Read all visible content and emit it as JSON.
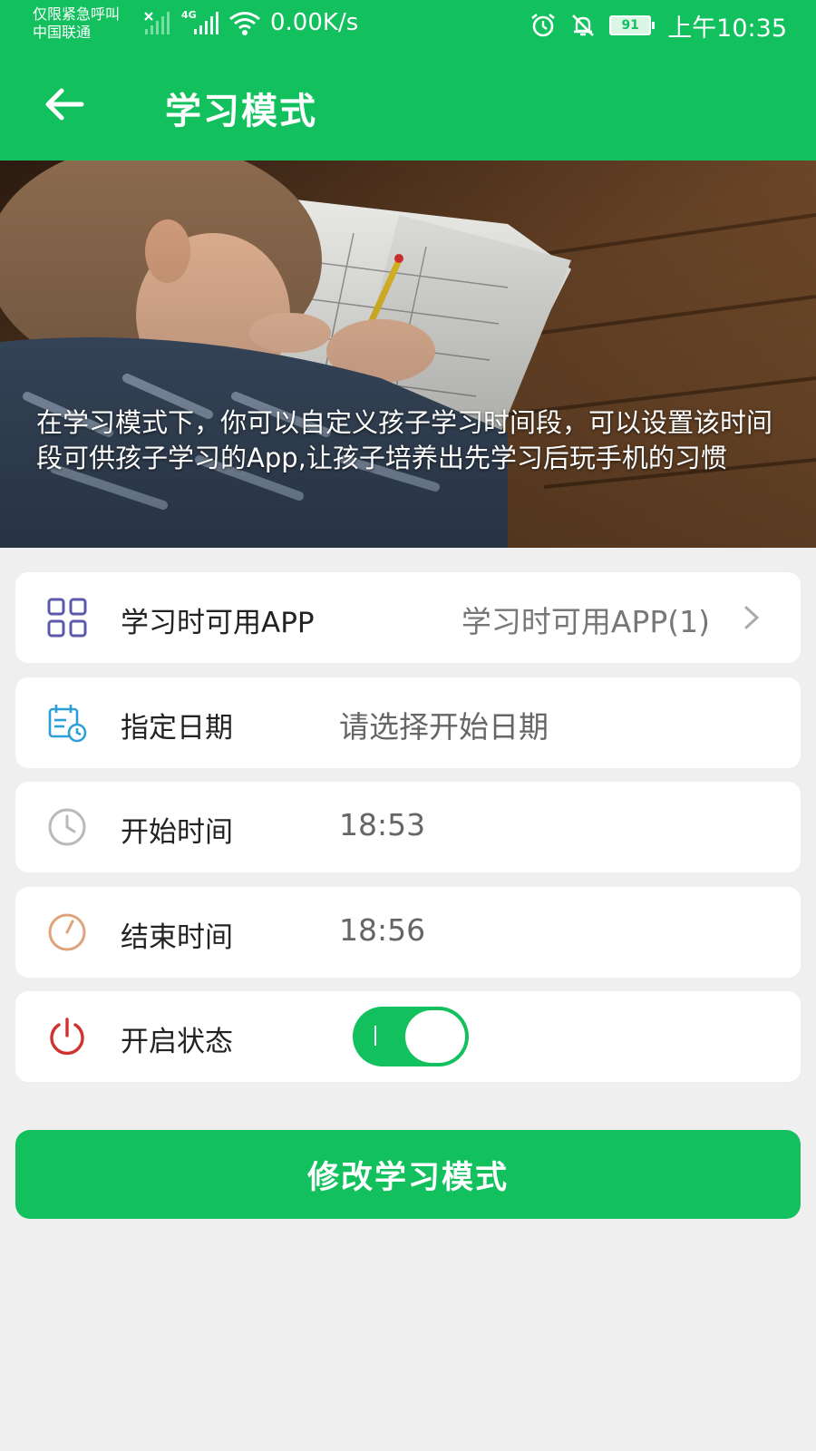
{
  "status_bar": {
    "carrier_line1": "仅限紧急呼叫",
    "carrier_line2": "中国联通",
    "network_tag": "4G",
    "net_speed": "0.00K/s",
    "battery": "91",
    "time": "上午10:35"
  },
  "header": {
    "title": "学习模式"
  },
  "banner": {
    "description": "在学习模式下，你可以自定义孩子学习时间段，可以设置该时间段可供孩子学习的App,让孩子培养出先学习后玩手机的习惯"
  },
  "rows": [
    {
      "label": "学习时可用APP",
      "value": "学习时可用APP(1)",
      "icon": "grid-icon",
      "icon_color": "#5a5aa8"
    },
    {
      "label": "指定日期",
      "value": "请选择开始日期",
      "icon": "calendar-clock-icon",
      "icon_color": "#2a9fd8"
    },
    {
      "label": "开始时间",
      "value": "18:53",
      "icon": "clock-icon",
      "icon_color": "#b9b9b9"
    },
    {
      "label": "结束时间",
      "value": "18:56",
      "icon": "clock-end-icon",
      "icon_color": "#e0a37c"
    },
    {
      "label": "开启状态",
      "toggle_on": true,
      "icon": "power-icon",
      "icon_color": "#d0332f"
    }
  ],
  "primary_button": {
    "label": "修改学习模式"
  },
  "colors": {
    "brand": "#12c05e",
    "background": "#efefef"
  }
}
